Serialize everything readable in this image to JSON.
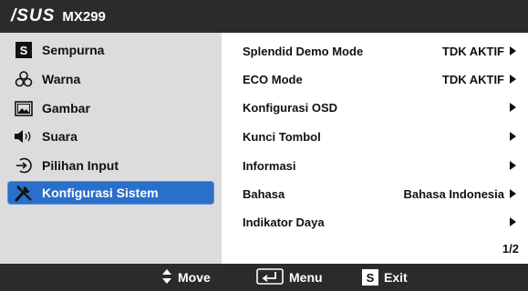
{
  "header": {
    "brand": "/SUS",
    "model": "MX299"
  },
  "sidebar": {
    "items": [
      {
        "label": "Sempurna",
        "icon": "splendid-s-icon"
      },
      {
        "label": "Warna",
        "icon": "color-icon"
      },
      {
        "label": "Gambar",
        "icon": "image-icon"
      },
      {
        "label": "Suara",
        "icon": "speaker-icon"
      },
      {
        "label": "Pilihan Input",
        "icon": "input-icon"
      },
      {
        "label": "Konfigurasi Sistem",
        "icon": "tools-icon",
        "selected": true
      }
    ]
  },
  "settings": {
    "rows": [
      {
        "label": "Splendid Demo Mode",
        "value": "TDK AKTIF"
      },
      {
        "label": "ECO Mode",
        "value": "TDK AKTIF"
      },
      {
        "label": "Konfigurasi OSD",
        "value": ""
      },
      {
        "label": "Kunci Tombol",
        "value": ""
      },
      {
        "label": "Informasi",
        "value": ""
      },
      {
        "label": "Bahasa",
        "value": "Bahasa Indonesia"
      },
      {
        "label": "Indikator Daya",
        "value": ""
      }
    ],
    "page": "1/2"
  },
  "footer": {
    "move_label": "Move",
    "menu_label": "Menu",
    "exit_key": "S",
    "exit_label": "Exit"
  },
  "colors": {
    "bar": "#2b2b2b",
    "sidebar": "#dcdcdc",
    "selected": "#2a6fc9"
  }
}
